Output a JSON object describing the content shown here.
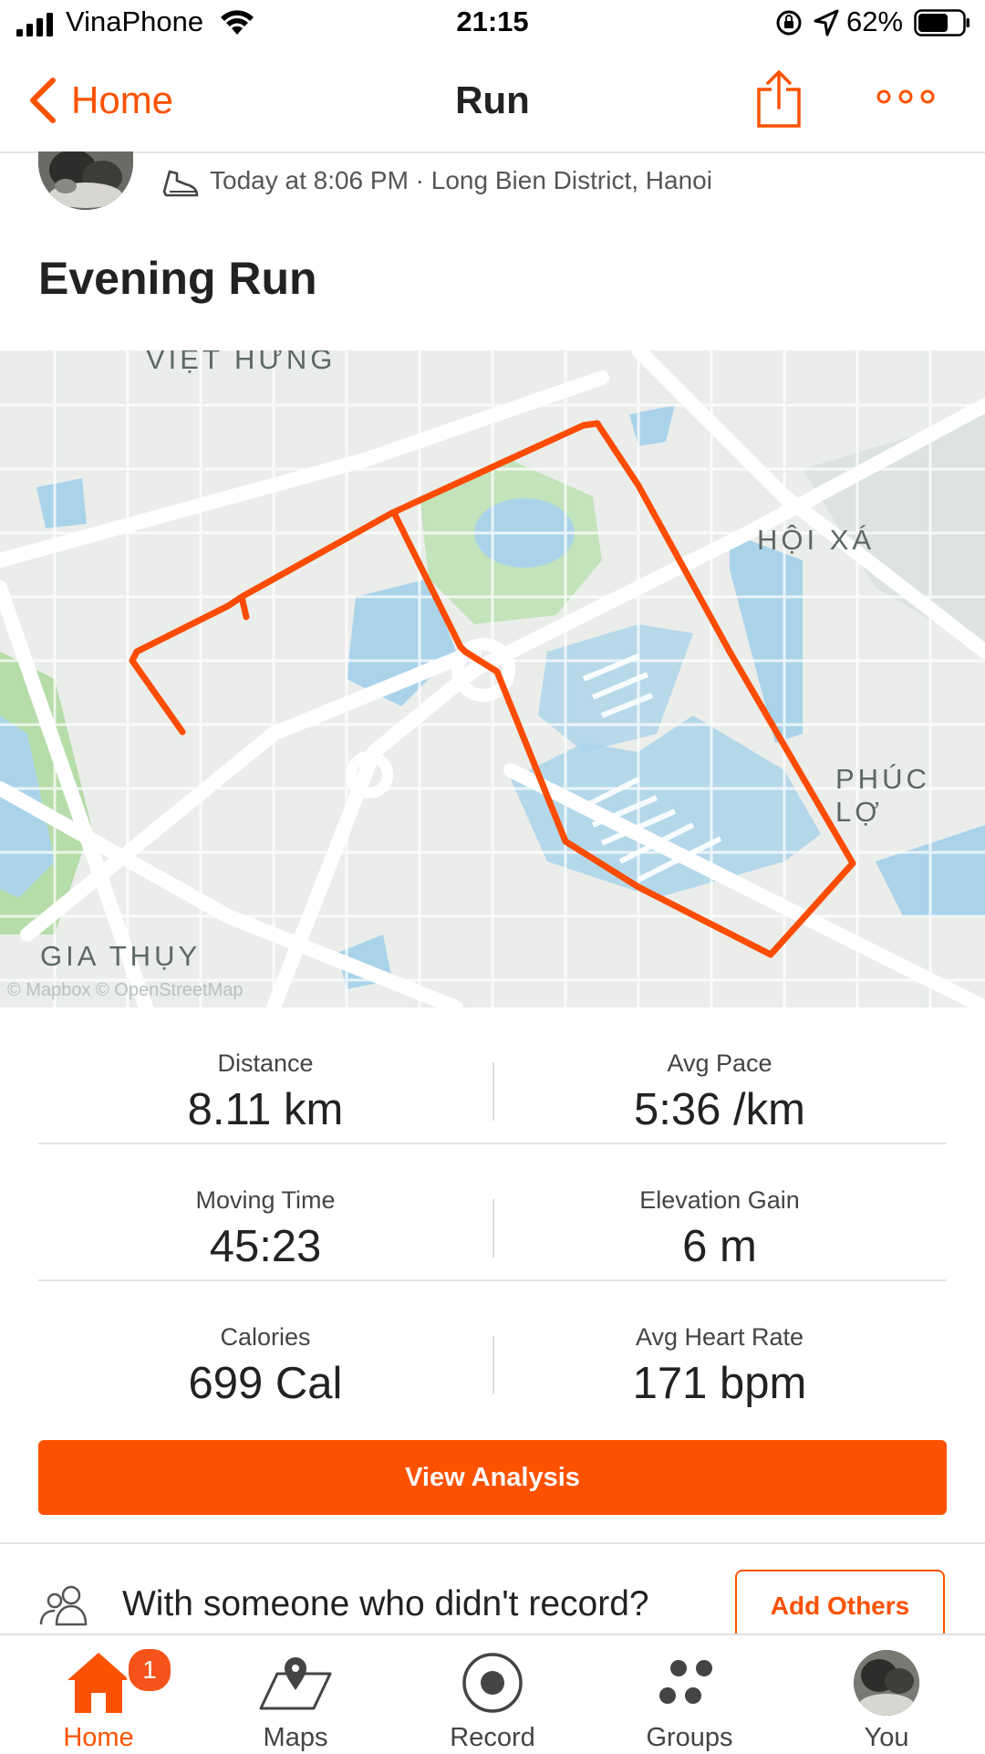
{
  "status_bar": {
    "carrier": "VinaPhone",
    "time": "21:15",
    "battery_percent": "62%"
  },
  "nav": {
    "back_label": "Home",
    "title": "Run"
  },
  "activity": {
    "meta": "Today at 8:06 PM · Long Bien District, Hanoi",
    "title": "Evening Run"
  },
  "map": {
    "labels": {
      "viet_hung": "VIỆT HƯNG",
      "hoi_xa": "HỘI XÁ",
      "phuc_loi": "PHÚC LỢ",
      "gia_thuy": "GIA THỤY"
    },
    "attribution": "© Mapbox © OpenStreetMap",
    "route_color": "#fc4c02"
  },
  "stats": [
    {
      "left": {
        "label": "Distance",
        "value": "8.11 km"
      },
      "right": {
        "label": "Avg Pace",
        "value": "5:36 /km"
      }
    },
    {
      "left": {
        "label": "Moving Time",
        "value": "45:23"
      },
      "right": {
        "label": "Elevation Gain",
        "value": "6 m"
      }
    },
    {
      "left": {
        "label": "Calories",
        "value": "699 Cal"
      },
      "right": {
        "label": "Avg Heart Rate",
        "value": "171 bpm"
      }
    }
  ],
  "buttons": {
    "view_analysis": "View Analysis",
    "add_others": "Add Others"
  },
  "with_someone": "With someone who didn't record?",
  "tabbar": {
    "badge": "1",
    "items": [
      {
        "label": "Home",
        "icon": "home-icon",
        "active": true
      },
      {
        "label": "Maps",
        "icon": "map-pin-icon"
      },
      {
        "label": "Record",
        "icon": "record-icon"
      },
      {
        "label": "Groups",
        "icon": "groups-icon"
      },
      {
        "label": "You",
        "icon": "avatar"
      }
    ]
  },
  "colors": {
    "brand": "#fc5200",
    "map_water": "#aad3ea",
    "map_park": "#c8e6c0"
  }
}
